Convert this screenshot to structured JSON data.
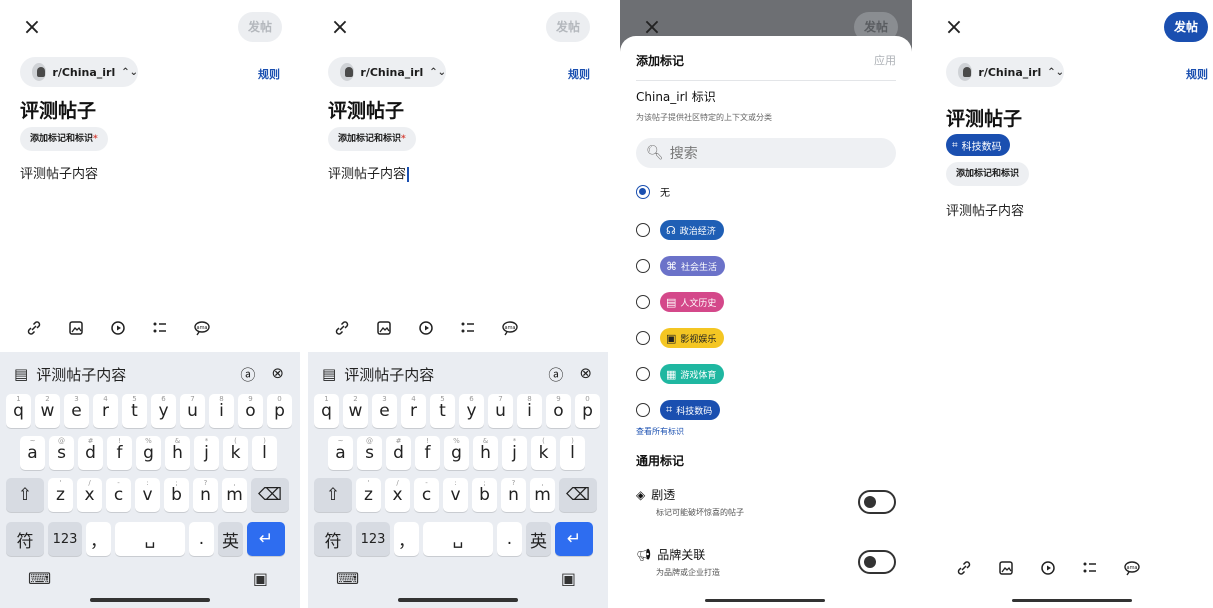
{
  "common": {
    "close_glyph": "×",
    "post_label": "发帖",
    "community": "r/China_irl",
    "rules": "规则",
    "post_title": "评测帖子",
    "add_flair_tags": "添加标记和标识",
    "required_mark": "*",
    "post_body": "评测帖子内容"
  },
  "keyboard": {
    "suggestion": "评测帖子内容",
    "row1": [
      {
        "key": "q",
        "hint": "1"
      },
      {
        "key": "w",
        "hint": "2"
      },
      {
        "key": "e",
        "hint": "3"
      },
      {
        "key": "r",
        "hint": "4"
      },
      {
        "key": "t",
        "hint": "5"
      },
      {
        "key": "y",
        "hint": "6"
      },
      {
        "key": "u",
        "hint": "7"
      },
      {
        "key": "i",
        "hint": "8"
      },
      {
        "key": "o",
        "hint": "9"
      },
      {
        "key": "p",
        "hint": "0"
      }
    ],
    "row2": [
      {
        "key": "a",
        "hint": "~"
      },
      {
        "key": "s",
        "hint": "@"
      },
      {
        "key": "d",
        "hint": "#"
      },
      {
        "key": "f",
        "hint": "!"
      },
      {
        "key": "g",
        "hint": "%"
      },
      {
        "key": "h",
        "hint": "&"
      },
      {
        "key": "j",
        "hint": "*"
      },
      {
        "key": "k",
        "hint": "("
      },
      {
        "key": "l",
        "hint": ")"
      }
    ],
    "row3": [
      {
        "key": "z",
        "hint": "'"
      },
      {
        "key": "x",
        "hint": "/"
      },
      {
        "key": "c",
        "hint": "-"
      },
      {
        "key": "v",
        "hint": ":"
      },
      {
        "key": "b",
        "hint": ";"
      },
      {
        "key": "n",
        "hint": "?"
      },
      {
        "key": "m",
        "hint": ","
      }
    ],
    "symbols": "符",
    "numbers": "123",
    "comma": "，",
    "period": ".",
    "lang": "英"
  },
  "flair_sheet": {
    "title": "添加标记",
    "apply": "应用",
    "section_title": "China_irl 标识",
    "section_sub": "为该帖子提供社区特定的上下文或分类",
    "search_placeholder": "搜索",
    "none_option": "无",
    "options": [
      {
        "label": "政治经济",
        "color": "#1f5fb5",
        "icon": "people-icon"
      },
      {
        "label": "社会生活",
        "color": "#6b72c9",
        "icon": "network-icon"
      },
      {
        "label": "人文历史",
        "color": "#d4488a",
        "icon": "book-icon"
      },
      {
        "label": "影视娱乐",
        "color": "#f4c623",
        "icon": "film-icon"
      },
      {
        "label": "游戏体育",
        "color": "#1fb7a1",
        "icon": "grid-icon"
      },
      {
        "label": "科技数码",
        "color": "#1a4fb0",
        "icon": "chip-icon"
      }
    ],
    "see_all": "查看所有标识",
    "general_title": "通用标记",
    "spoiler_name": "剧透",
    "spoiler_desc": "标记可能破坏惊喜的帖子",
    "brand_name": "品牌关联",
    "brand_desc": "为品牌或企业打造"
  },
  "result": {
    "selected_flair": "科技数码"
  }
}
